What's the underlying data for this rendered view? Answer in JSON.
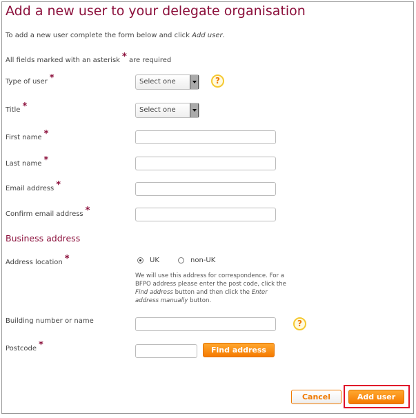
{
  "page": {
    "title": "Add a new user to your delegate organisation",
    "intro_prefix": "To add a new user complete the form below and click ",
    "intro_em": "Add user",
    "intro_suffix": ".",
    "required_prefix": "All fields marked with an asterisk",
    "required_suffix": " are required",
    "asterisk": "*"
  },
  "fields": {
    "type_of_user": {
      "label": "Type of user",
      "value": "Select one",
      "help": "?"
    },
    "title": {
      "label": "Title",
      "value": "Select one"
    },
    "first_name": {
      "label": "First name",
      "value": ""
    },
    "last_name": {
      "label": "Last name",
      "value": ""
    },
    "email": {
      "label": "Email address",
      "value": ""
    },
    "confirm_email": {
      "label": "Confirm email address",
      "value": ""
    }
  },
  "business": {
    "heading": "Business address",
    "location_label": "Address location",
    "options": [
      {
        "label": "UK",
        "selected": true
      },
      {
        "label": "non-UK",
        "selected": false
      }
    ],
    "note": {
      "t1": "We will use this address for correspondence. For a BFPO address please enter the post code, click the ",
      "e1": "Find address",
      "t2": " button and then click the ",
      "e2": "Enter address manually",
      "t3": " button."
    },
    "building_label": "Building number or name",
    "building_value": "",
    "help": "?",
    "postcode_label": "Postcode",
    "postcode_value": "",
    "find_label": "Find address"
  },
  "actions": {
    "cancel": "Cancel",
    "add": "Add user"
  },
  "colors": {
    "heading": "#8b0f3b",
    "button": "#f57a00",
    "highlight": "#e0102a"
  }
}
